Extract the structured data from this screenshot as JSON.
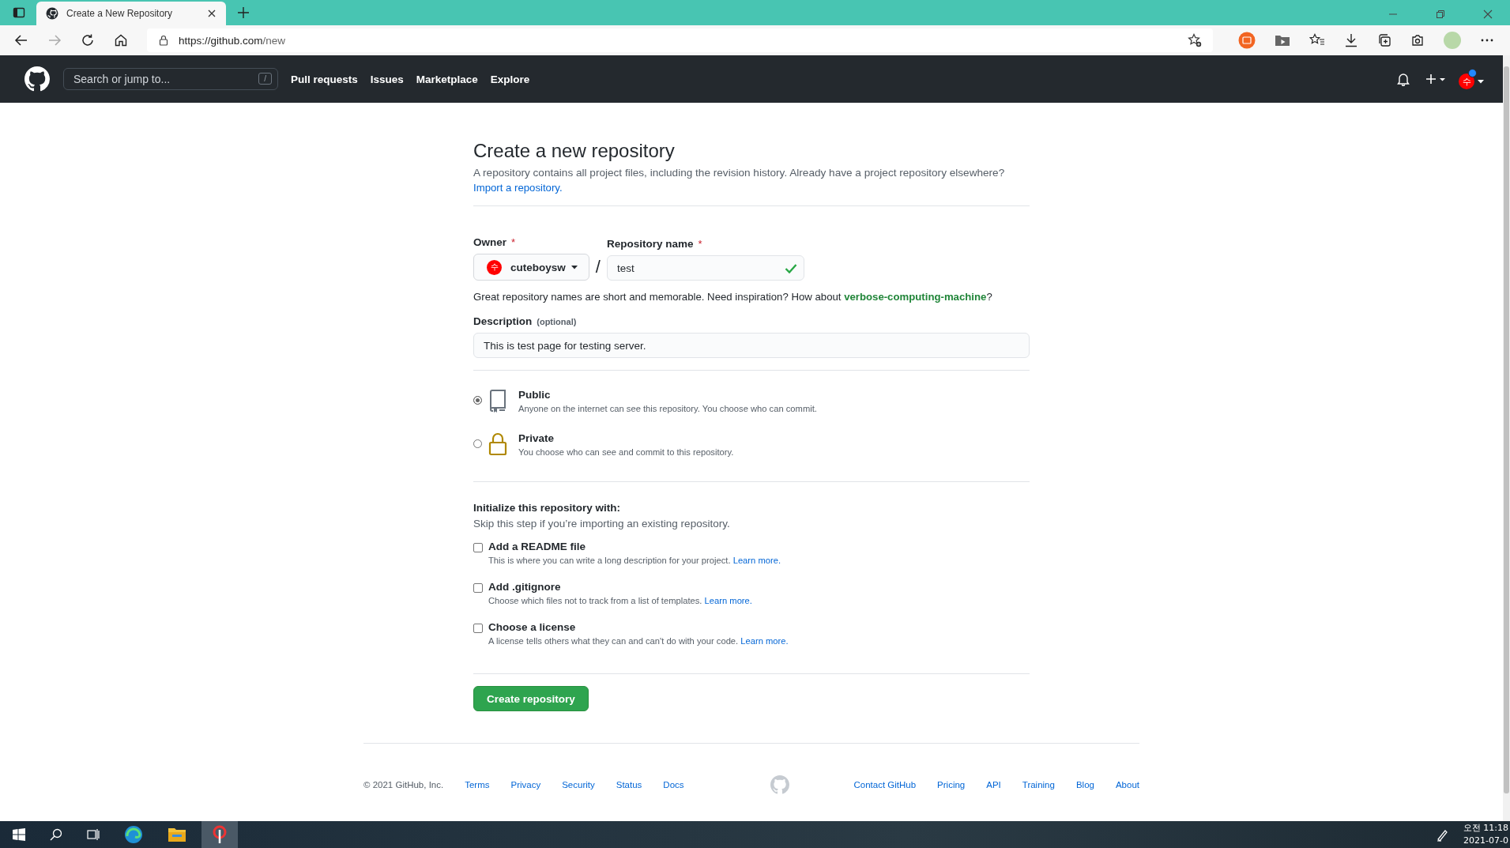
{
  "browser": {
    "tab": {
      "title": "Create a New Repository",
      "selected": true
    },
    "url_host": "https://github.com",
    "url_path": "/new"
  },
  "header": {
    "search_placeholder": "Search or jump to...",
    "search_key": "/",
    "nav": [
      "Pull requests",
      "Issues",
      "Marketplace",
      "Explore"
    ],
    "avatar_initial": "수"
  },
  "form": {
    "title": "Create a new repository",
    "intro": "A repository contains all project files, including the revision history. Already have a project repository elsewhere?",
    "import_link": "Import a repository.",
    "owner_label": "Owner",
    "required_mark": "*",
    "owner": {
      "name": "cuteboysw",
      "initial": "수"
    },
    "separator": "/",
    "repo_label": "Repository name",
    "repo_value": "test",
    "repo_valid": true,
    "hint": "Great repository names are short and memorable. Need inspiration? How about ",
    "suggestion": "verbose-computing-machine",
    "hint_end": "?",
    "description_label": "Description",
    "description_optional": "(optional)",
    "description_value": "This is test page for testing server.",
    "visibility": [
      {
        "kind": "public",
        "label": "Public",
        "note": "Anyone on the internet can see this repository. You choose who can commit.",
        "selected": true
      },
      {
        "kind": "private",
        "label": "Private",
        "note": "You choose who can see and commit to this repository.",
        "selected": false
      }
    ],
    "init_title": "Initialize this repository with:",
    "init_note": "Skip this step if you’re importing an existing repository.",
    "options": [
      {
        "label": "Add a README file",
        "note": "This is where you can write a long description for your project.",
        "link": "Learn more.",
        "checked": false
      },
      {
        "label": "Add .gitignore",
        "note": "Choose which files not to track from a list of templates.",
        "link": "Learn more.",
        "checked": false
      },
      {
        "label": "Choose a license",
        "note": "A license tells others what they can and can't do with your code.",
        "link": "Learn more.",
        "checked": false
      }
    ],
    "submit": "Create repository"
  },
  "footer": {
    "copyright": "© 2021 GitHub, Inc.",
    "left_links": [
      "Terms",
      "Privacy",
      "Security",
      "Status",
      "Docs"
    ],
    "right_links": [
      "Contact GitHub",
      "Pricing",
      "API",
      "Training",
      "Blog",
      "About"
    ]
  },
  "taskbar": {
    "time": "오전 11:18",
    "date": "2021-07-0"
  }
}
